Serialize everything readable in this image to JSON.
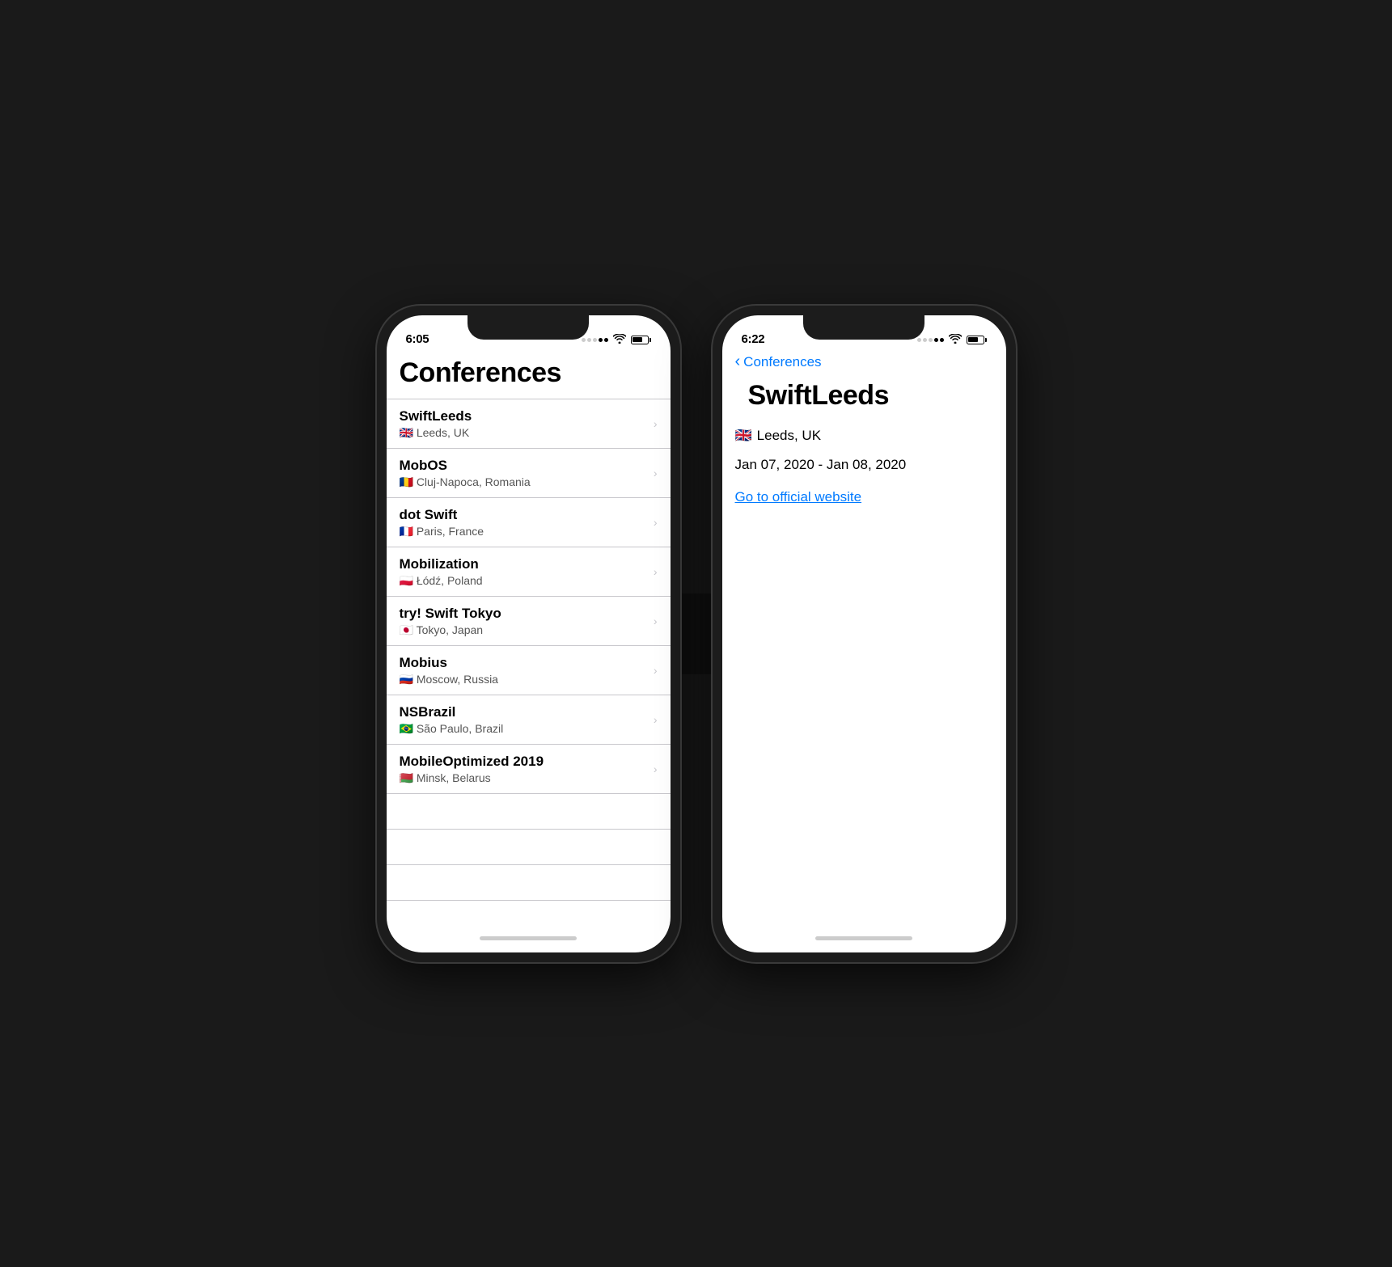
{
  "phone1": {
    "status_time": "6:05",
    "title": "Conferences",
    "conferences": [
      {
        "name": "SwiftLeeds",
        "flag": "🇬🇧",
        "location": "Leeds, UK"
      },
      {
        "name": "MobOS",
        "flag": "🇷🇴",
        "location": "Cluj-Napoca, Romania"
      },
      {
        "name": "dot Swift",
        "flag": "🇫🇷",
        "location": "Paris, France"
      },
      {
        "name": "Mobilization",
        "flag": "🇵🇱",
        "location": "Łódź, Poland"
      },
      {
        "name": "try! Swift Tokyo",
        "flag": "🇯🇵",
        "location": "Tokyo, Japan"
      },
      {
        "name": "Mobius",
        "flag": "🇷🇺",
        "location": "Moscow, Russia"
      },
      {
        "name": "NSBrazil",
        "flag": "🇧🇷",
        "location": "São Paulo, Brazil"
      },
      {
        "name": "MobileOptimized 2019",
        "flag": "🇧🇾",
        "location": "Minsk, Belarus"
      }
    ]
  },
  "phone2": {
    "status_time": "6:22",
    "back_label": "Conferences",
    "detail_title": "SwiftLeeds",
    "detail_flag": "🇬🇧",
    "detail_location": "Leeds, UK",
    "detail_dates": "Jan 07, 2020 - Jan 08, 2020",
    "detail_link": "Go to official website"
  },
  "icons": {
    "back_chevron": "‹",
    "chevron_right": "›",
    "wifi": "wifi"
  }
}
